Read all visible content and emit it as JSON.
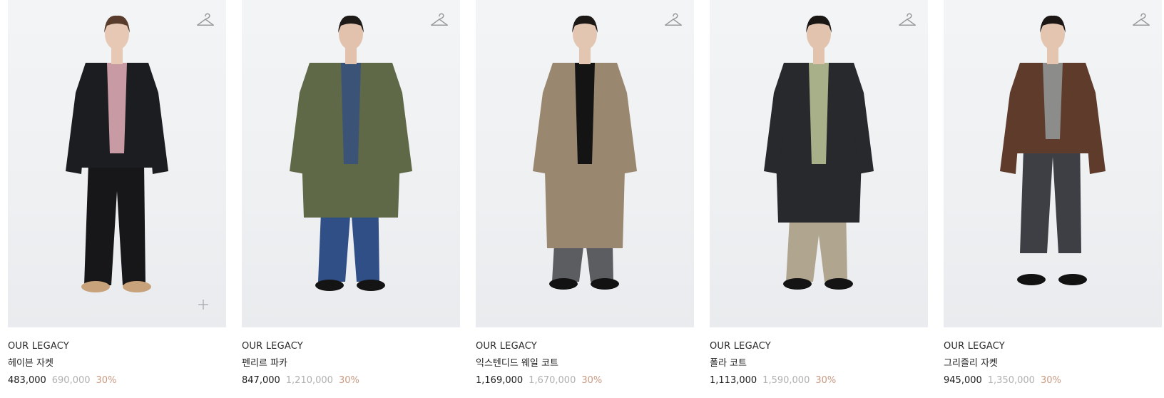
{
  "products": [
    {
      "brand": "OUR LEGACY",
      "name": "헤이븐 자켓",
      "sale_price": "483,000",
      "original_price": "690,000",
      "discount": "30%",
      "colors": {
        "top": "#1c1d20",
        "inner": "#c89aa3",
        "bottom": "#17171a",
        "shoes": "#c7a27a",
        "skin": "#e6c8b4",
        "hair": "#5a3c2c"
      }
    },
    {
      "brand": "OUR LEGACY",
      "name": "펜리르 파카",
      "sale_price": "847,000",
      "original_price": "1,210,000",
      "discount": "30%",
      "colors": {
        "top": "#5f6947",
        "inner": "#3c5378",
        "bottom": "#2f4f86",
        "shoes": "#141414",
        "skin": "#e2c2ac",
        "hair": "#1e1a18"
      }
    },
    {
      "brand": "OUR LEGACY",
      "name": "익스텐디드 웨일 코트",
      "sale_price": "1,169,000",
      "original_price": "1,670,000",
      "discount": "30%",
      "colors": {
        "top": "#9a876f",
        "inner": "#141414",
        "bottom": "#5b5d61",
        "shoes": "#121212",
        "skin": "#e3c6b2",
        "hair": "#1c1816"
      }
    },
    {
      "brand": "OUR LEGACY",
      "name": "폴라 코트",
      "sale_price": "1,113,000",
      "original_price": "1,590,000",
      "discount": "30%",
      "colors": {
        "top": "#27292d",
        "inner": "#a8b08a",
        "bottom": "#b0a58f",
        "shoes": "#141414",
        "skin": "#e2c3ae",
        "hair": "#1a1614"
      }
    },
    {
      "brand": "OUR LEGACY",
      "name": "그리즐리 자켓",
      "sale_price": "945,000",
      "original_price": "1,350,000",
      "discount": "30%",
      "colors": {
        "top": "#5e3b2a",
        "inner": "#8c8c8a",
        "bottom": "#3d3f44",
        "shoes": "#121212",
        "skin": "#e3c5b0",
        "hair": "#1c1715"
      }
    }
  ],
  "icons": {
    "wishlist": "hanger-icon",
    "quick_add": "plus-icon"
  }
}
